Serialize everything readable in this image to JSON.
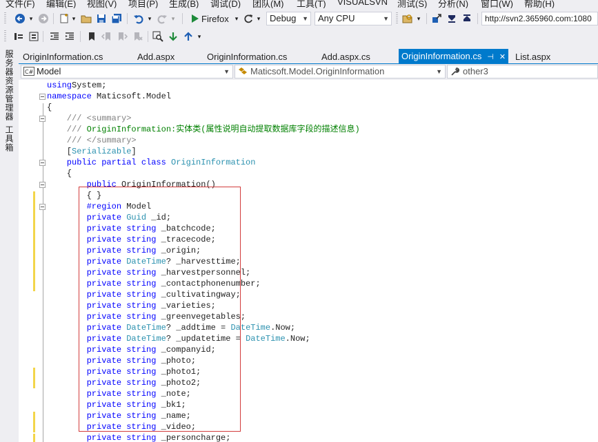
{
  "menu": [
    "文件(F)",
    "编辑(E)",
    "视图(V)",
    "项目(P)",
    "生成(B)",
    "调试(D)",
    "团队(M)",
    "工具(T)",
    "VISUALSVN",
    "测试(S)",
    "分析(N)",
    "窗口(W)",
    "帮助(H)"
  ],
  "toolbar": {
    "run_target": "Firefox",
    "configuration": "Debug",
    "platform": "Any CPU",
    "url": "http://svn2.365960.com:1080"
  },
  "side_panels": [
    "服务器资源管理器",
    "工具箱"
  ],
  "tabs": [
    "OriginInformation.cs",
    "Add.aspx",
    "OriginInformation.cs",
    "Add.aspx.cs",
    "OriginInformation.cs",
    "List.aspx"
  ],
  "active_tab": "OriginInformation.cs",
  "nav": {
    "project": "Model",
    "type": "Maticsoft.Model.OriginInformation",
    "member": "other3"
  },
  "code": [
    [
      [
        "kw",
        "using"
      ],
      [
        "",
        "System;"
      ]
    ],
    [
      [
        "kw",
        "namespace"
      ],
      [
        "",
        " Maticsoft.Model"
      ]
    ],
    [
      [
        "",
        "{"
      ]
    ],
    [
      [
        "cg",
        "    ///"
      ],
      [
        "cm",
        " "
      ],
      [
        "cg",
        "<summary>"
      ]
    ],
    [
      [
        "cg",
        "    ///"
      ],
      [
        "cm",
        " OriginInformation:实体类(属性说明自动提取数据库字段的描述信息)"
      ]
    ],
    [
      [
        "cg",
        "    ///"
      ],
      [
        "cm",
        " "
      ],
      [
        "cg",
        "</summary>"
      ]
    ],
    [
      [
        "",
        "    ["
      ],
      [
        "ty",
        "Serializable"
      ],
      [
        "",
        "]"
      ]
    ],
    [
      [
        "kw",
        "    public partial class"
      ],
      [
        "",
        " "
      ],
      [
        "ty",
        "OriginInformation"
      ]
    ],
    [
      [
        "",
        "    {"
      ]
    ],
    [
      [
        "kw",
        "        public"
      ],
      [
        "",
        " OriginInformation()"
      ]
    ],
    [
      [
        "",
        "        { }"
      ]
    ],
    [
      [
        "kw",
        "        #region"
      ],
      [
        "",
        " Model"
      ]
    ],
    [
      [
        "kw",
        "        private"
      ],
      [
        "",
        " "
      ],
      [
        "ty",
        "Guid"
      ],
      [
        "",
        " _id;"
      ]
    ],
    [
      [
        "kw",
        "        private string"
      ],
      [
        "",
        " _batchcode;"
      ]
    ],
    [
      [
        "kw",
        "        private string"
      ],
      [
        "",
        " _tracecode;"
      ]
    ],
    [
      [
        "kw",
        "        private string"
      ],
      [
        "",
        " _origin;"
      ]
    ],
    [
      [
        "kw",
        "        private"
      ],
      [
        "",
        " "
      ],
      [
        "ty",
        "DateTime"
      ],
      [
        "",
        "? _harvesttime;"
      ]
    ],
    [
      [
        "kw",
        "        private string"
      ],
      [
        "",
        " _harvestpersonnel;"
      ]
    ],
    [
      [
        "kw",
        "        private string"
      ],
      [
        "",
        " _contactphonenumber;"
      ]
    ],
    [
      [
        "kw",
        "        private string"
      ],
      [
        "",
        " _cultivatingway;"
      ]
    ],
    [
      [
        "kw",
        "        private string"
      ],
      [
        "",
        " _varieties;"
      ]
    ],
    [
      [
        "kw",
        "        private string"
      ],
      [
        "",
        " _greenvegetables;"
      ]
    ],
    [
      [
        "kw",
        "        private"
      ],
      [
        "",
        " "
      ],
      [
        "ty",
        "DateTime"
      ],
      [
        "",
        "? _addtime = "
      ],
      [
        "ty",
        "DateTime"
      ],
      [
        "",
        ".Now;"
      ]
    ],
    [
      [
        "kw",
        "        private"
      ],
      [
        "",
        " "
      ],
      [
        "ty",
        "DateTime"
      ],
      [
        "",
        "? _updatetime = "
      ],
      [
        "ty",
        "DateTime"
      ],
      [
        "",
        ".Now;"
      ]
    ],
    [
      [
        "kw",
        "        private string"
      ],
      [
        "",
        " _companyid;"
      ]
    ],
    [
      [
        "kw",
        "        private string"
      ],
      [
        "",
        " _photo;"
      ]
    ],
    [
      [
        "kw",
        "        private string"
      ],
      [
        "",
        " _photo1;"
      ]
    ],
    [
      [
        "kw",
        "        private string"
      ],
      [
        "",
        " _photo2;"
      ]
    ],
    [
      [
        "kw",
        "        private string"
      ],
      [
        "",
        " _note;"
      ]
    ],
    [
      [
        "kw",
        "        private string"
      ],
      [
        "",
        " _bk1;"
      ]
    ],
    [
      [
        "kw",
        "        private string"
      ],
      [
        "",
        " _name;"
      ]
    ],
    [
      [
        "kw",
        "        private string"
      ],
      [
        "",
        " _video;"
      ]
    ],
    [
      [
        "kw",
        "        private string"
      ],
      [
        "",
        " _personcharge;"
      ]
    ]
  ],
  "colors": {
    "accent": "#007acc",
    "keyword": "#0000ff",
    "type": "#2b91af",
    "comment": "#008000",
    "highlight_box": "#d23b3b",
    "change_marker": "#f3d54a"
  }
}
